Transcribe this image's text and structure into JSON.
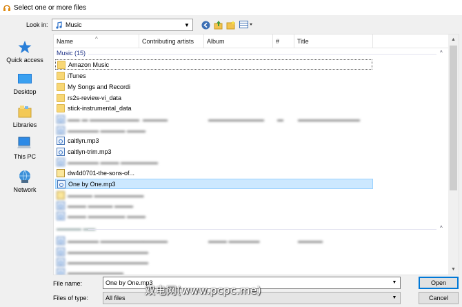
{
  "window": {
    "title": "Select one or more files"
  },
  "lookin": {
    "label": "Look in:",
    "value": "Music"
  },
  "toolbar": {
    "icons": [
      "back-icon",
      "up-folder-icon",
      "new-folder-icon",
      "view-menu-icon"
    ]
  },
  "places": [
    {
      "label": "Quick access",
      "icon": "star-icon"
    },
    {
      "label": "Desktop",
      "icon": "desktop-icon"
    },
    {
      "label": "Libraries",
      "icon": "libraries-icon"
    },
    {
      "label": "This PC",
      "icon": "computer-icon"
    },
    {
      "label": "Network",
      "icon": "network-icon"
    }
  ],
  "columns": [
    "Name",
    "Contributing artists",
    "Album",
    "#",
    "Title"
  ],
  "groups": [
    {
      "label": "Music (15)"
    }
  ],
  "rows": [
    {
      "name": "Amazon Music",
      "type": "folder"
    },
    {
      "name": "iTunes",
      "type": "folder"
    },
    {
      "name": "My Songs and Recordi",
      "type": "folder"
    },
    {
      "name": "rs2s-review-vi_data",
      "type": "folder"
    },
    {
      "name": "stick-instrumental_data",
      "type": "folder"
    },
    {
      "name": "caitlyn.mp3",
      "type": "mp3"
    },
    {
      "name": "caitlyn-trim.mp3",
      "type": "mp3"
    },
    {
      "name": "dw4d0701-the-sons-of...",
      "type": "zip"
    },
    {
      "name": "One by One.mp3",
      "type": "mp3"
    }
  ],
  "filename": {
    "label": "File name:",
    "value": "One by One.mp3"
  },
  "filetype": {
    "label": "Files of type:",
    "value": "All files"
  },
  "buttons": {
    "open": "Open",
    "cancel": "Cancel"
  },
  "watermark": "双电网(www.pcpc.me)"
}
